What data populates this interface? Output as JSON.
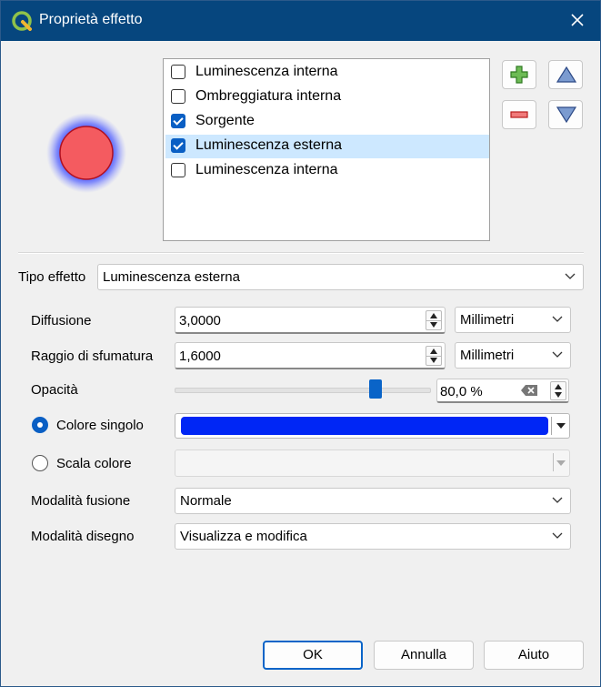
{
  "window": {
    "title": "Proprietà effetto"
  },
  "effects": [
    {
      "label": "Luminescenza interna",
      "checked": false
    },
    {
      "label": "Ombreggiatura interna",
      "checked": false
    },
    {
      "label": "Sorgente",
      "checked": true
    },
    {
      "label": "Luminescenza esterna",
      "checked": true,
      "selected": true
    },
    {
      "label": "Luminescenza interna",
      "checked": false
    }
  ],
  "effect_type": {
    "label": "Tipo effetto",
    "value": "Luminescenza esterna"
  },
  "diffusion": {
    "label": "Diffusione",
    "value": "3,0000",
    "unit": "Millimetri"
  },
  "blur_radius": {
    "label": "Raggio di sfumatura",
    "value": "1,6000",
    "unit": "Millimetri"
  },
  "opacity": {
    "label": "Opacità",
    "value": "80,0 %",
    "level": 0.8
  },
  "single_color": {
    "label": "Colore singolo",
    "selected": true,
    "color": "#0026f5"
  },
  "color_ramp": {
    "label": "Scala colore",
    "selected": false
  },
  "blend_mode": {
    "label": "Modalità fusione",
    "value": "Normale"
  },
  "draw_mode": {
    "label": "Modalità disegno",
    "value": "Visualizza e modifica"
  },
  "buttons": {
    "ok": "OK",
    "cancel": "Annulla",
    "help": "Aiuto"
  },
  "colors": {
    "titlebar": "#06467e",
    "preview_fill": "#f45b60",
    "glow": "#3a4cff",
    "accent": "#0a64c8"
  }
}
